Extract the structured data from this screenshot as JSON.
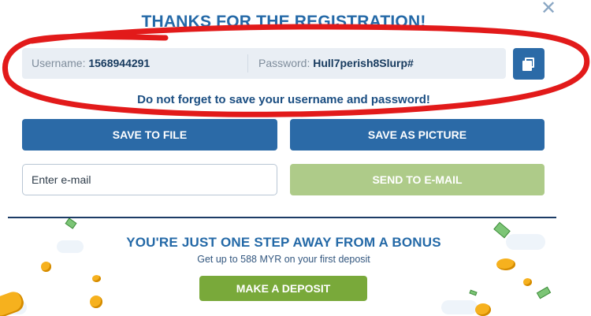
{
  "dialog": {
    "title": "THANKS FOR THE REGISTRATION!",
    "close_symbol": "✕"
  },
  "credentials": {
    "username_label": "Username:",
    "username_value": "1568944291",
    "password_label": "Password:",
    "password_value": "Hull7perish8Slurp#"
  },
  "reminder": "Do not forget to save your username and password!",
  "actions": {
    "save_file": "SAVE TO FILE",
    "save_picture": "SAVE AS PICTURE",
    "email_placeholder": "Enter e-mail",
    "send_email": "SEND TO E-MAIL"
  },
  "promo": {
    "title": "YOU'RE JUST ONE STEP AWAY FROM A BONUS",
    "subtitle": "Get up to 588 MYR on your first deposit",
    "deposit_button": "MAKE A DEPOSIT"
  },
  "icons": {
    "close": "close-icon",
    "copy": "copy-icon"
  },
  "colors": {
    "primary": "#2b6aa7",
    "title": "#2469a7",
    "send_disabled": "#aecb89",
    "deposit": "#79a93a",
    "annotation": "#e21a1a"
  }
}
